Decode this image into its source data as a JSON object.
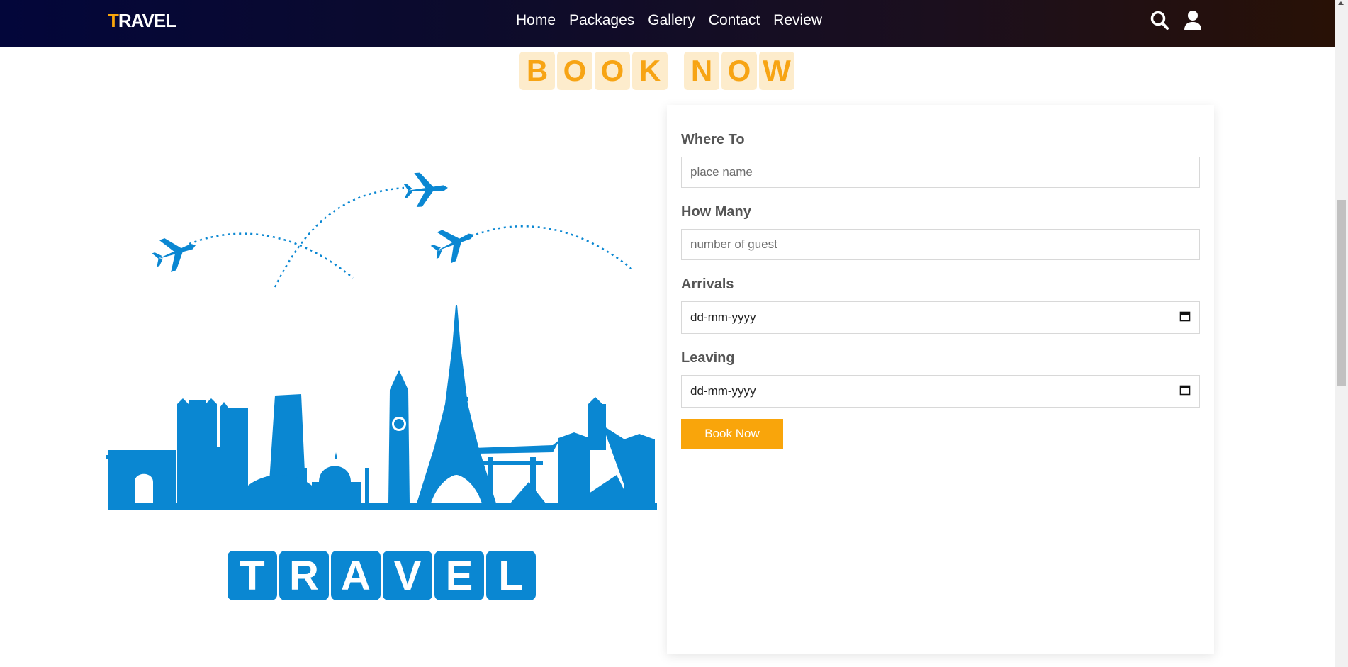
{
  "navbar": {
    "logo_first": "T",
    "logo_rest": "RAVEL",
    "links": [
      "Home",
      "Packages",
      "Gallery",
      "Contact",
      "Review"
    ],
    "icons": [
      "search-icon",
      "user-icon"
    ]
  },
  "heading": {
    "word1": [
      "B",
      "O",
      "O",
      "K"
    ],
    "word2": [
      "N",
      "O",
      "W"
    ]
  },
  "illustration": {
    "tiles": [
      "T",
      "R",
      "A",
      "V",
      "E",
      "L"
    ]
  },
  "form": {
    "where_label": "Where To",
    "where_placeholder": "place name",
    "how_many_label": "How Many",
    "how_many_placeholder": "number of guest",
    "arrivals_label": "Arrivals",
    "arrivals_value": "dd-mm-yyyy",
    "leaving_label": "Leaving",
    "leaving_value": "dd-mm-yyyy",
    "submit_label": "Book Now"
  },
  "colors": {
    "accent": "#f9a50b",
    "illustration_blue": "#0a87d2",
    "heading_tile_bg": "#fdeccc"
  }
}
